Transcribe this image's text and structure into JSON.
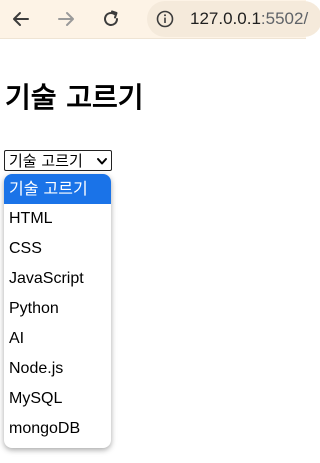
{
  "browser": {
    "back_icon": "arrow-left-icon",
    "forward_icon": "arrow-right-icon",
    "reload_icon": "reload-icon",
    "info_icon": "info-icon",
    "url_host": "127.0.0.1",
    "url_rest": ":5502/"
  },
  "page": {
    "title": "기술 고르기"
  },
  "select": {
    "value": "기술 고르기",
    "options": [
      "기술 고르기",
      "HTML",
      "CSS",
      "JavaScript",
      "Python",
      "AI",
      "Node.js",
      "MySQL",
      "mongoDB"
    ],
    "selected_index": 0,
    "highlight_color": "#1a73e8"
  }
}
